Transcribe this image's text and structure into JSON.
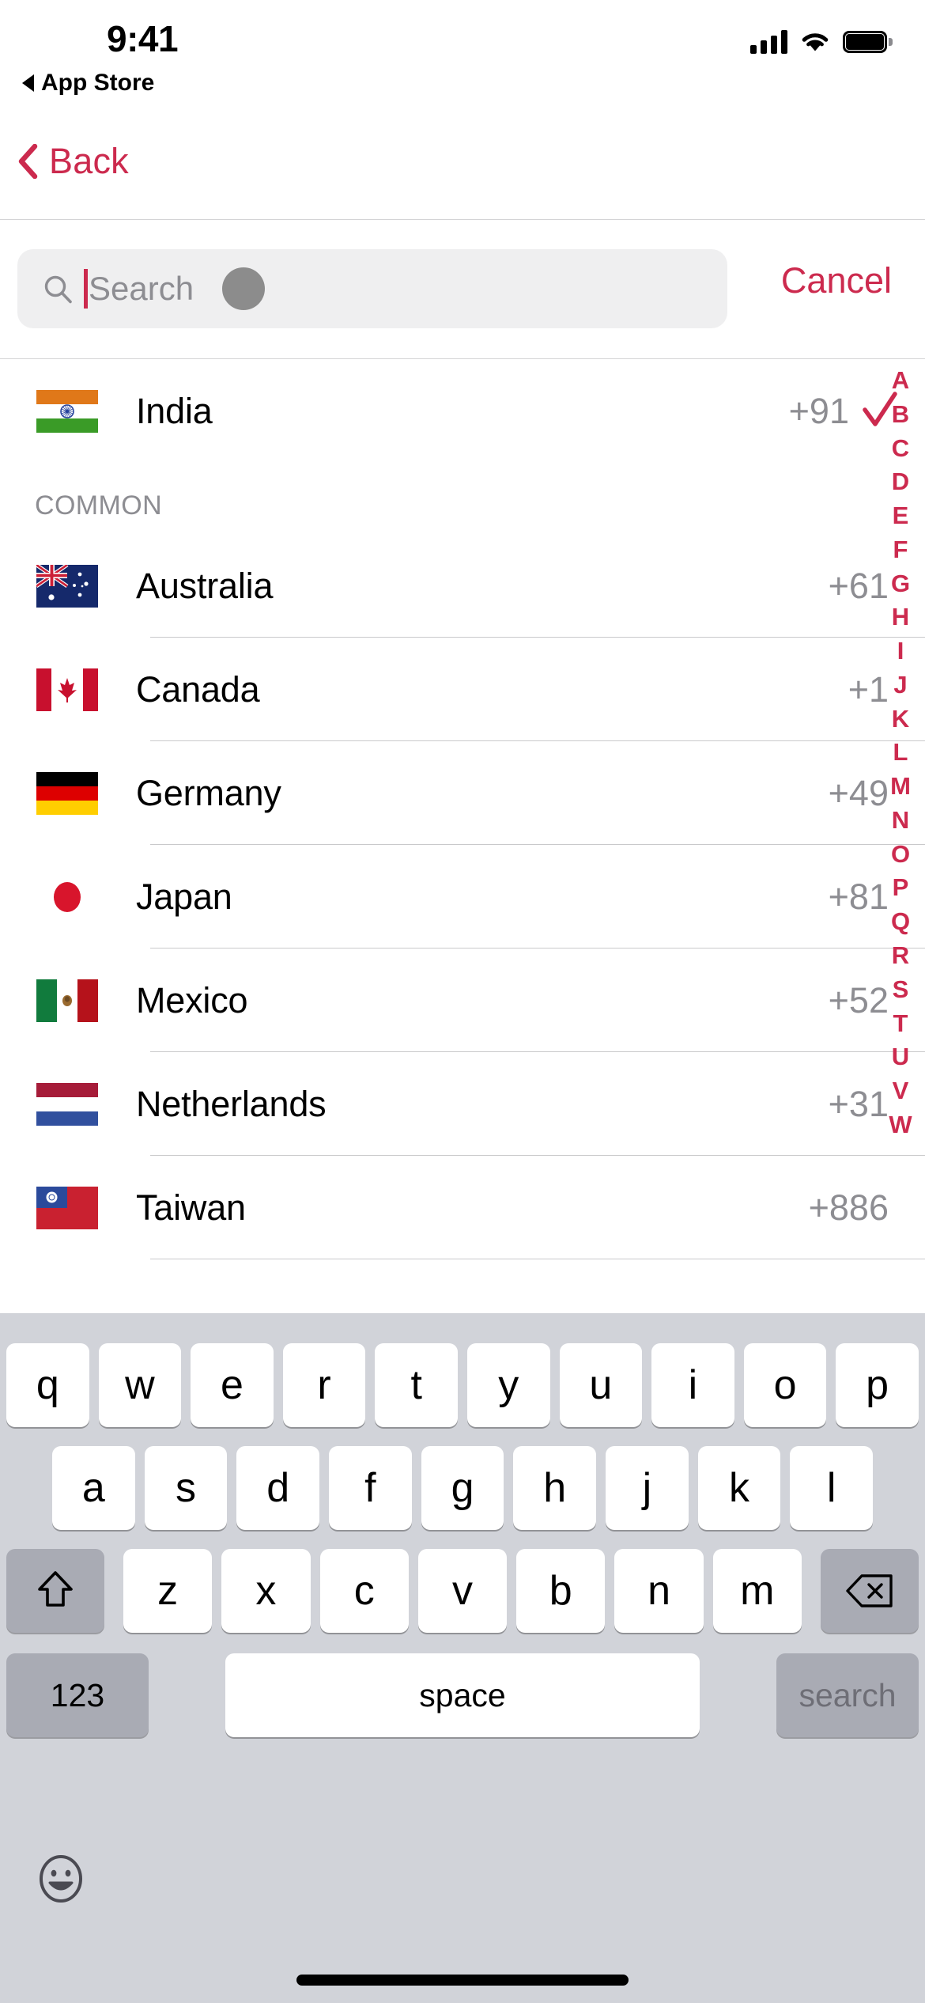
{
  "status_bar": {
    "time": "9:41",
    "app_return_label": "App Store",
    "signal_icon": "cellular-bars-icon",
    "wifi_icon": "wifi-icon",
    "battery_icon": "battery-full-icon"
  },
  "nav": {
    "back_label": "Back",
    "back_icon": "chevron-left-icon"
  },
  "search": {
    "placeholder": "Search",
    "value": "",
    "icon": "search-icon",
    "cancel_label": "Cancel"
  },
  "selected": {
    "flag": "flag-india",
    "name": "India",
    "dial_code": "+91",
    "check_icon": "checkmark-icon"
  },
  "section": {
    "header": "COMMON"
  },
  "countries": [
    {
      "flag": "flag-australia",
      "name": "Australia",
      "dial_code": "+61"
    },
    {
      "flag": "flag-canada",
      "name": "Canada",
      "dial_code": "+1"
    },
    {
      "flag": "flag-germany",
      "name": "Germany",
      "dial_code": "+49"
    },
    {
      "flag": "flag-japan",
      "name": "Japan",
      "dial_code": "+81"
    },
    {
      "flag": "flag-mexico",
      "name": "Mexico",
      "dial_code": "+52"
    },
    {
      "flag": "flag-netherlands",
      "name": "Netherlands",
      "dial_code": "+31"
    },
    {
      "flag": "flag-taiwan",
      "name": "Taiwan",
      "dial_code": "+886"
    }
  ],
  "index_rail": [
    "A",
    "B",
    "C",
    "D",
    "E",
    "F",
    "G",
    "H",
    "I",
    "J",
    "K",
    "L",
    "M",
    "N",
    "O",
    "P",
    "Q",
    "R",
    "S",
    "T",
    "U",
    "V",
    "W"
  ],
  "keyboard": {
    "row1": [
      "q",
      "w",
      "e",
      "r",
      "t",
      "y",
      "u",
      "i",
      "o",
      "p"
    ],
    "row2": [
      "a",
      "s",
      "d",
      "f",
      "g",
      "h",
      "j",
      "k",
      "l"
    ],
    "row3": [
      "z",
      "x",
      "c",
      "v",
      "b",
      "n",
      "m"
    ],
    "shift_icon": "shift-arrow-icon",
    "delete_icon": "backspace-icon",
    "numeric_label": "123",
    "space_label": "space",
    "return_label": "search",
    "emoji_icon": "emoji-smiley-icon"
  },
  "colors": {
    "accent": "#cc2a4e",
    "secondary_text": "#8d8d92",
    "search_field_bg": "#efeff0",
    "keyboard_bg": "#d1d3d9",
    "modifier_key_bg": "#a9abb4"
  }
}
